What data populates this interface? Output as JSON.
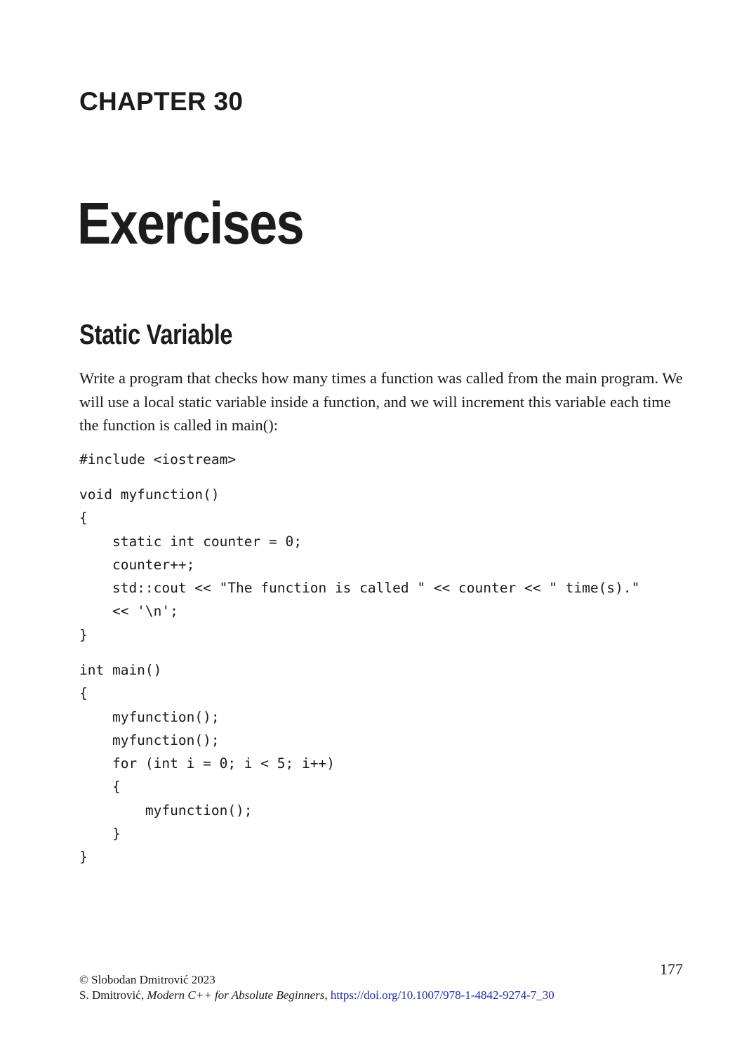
{
  "chapter": {
    "label": "CHAPTER 30",
    "title": "Exercises"
  },
  "section": {
    "title": "Static Variable",
    "paragraph": "Write a program that checks how many times a function was called from the main program. We will use a local static variable inside a function, and we will increment this variable each time the function is called in main():"
  },
  "code": {
    "include": [
      "#include <iostream>"
    ],
    "myfunction": [
      "void myfunction()",
      "{",
      "    static int counter = 0;",
      "    counter++;",
      "    std::cout << \"The function is called \" << counter << \" time(s).\"",
      "    << '\\n';",
      "}"
    ],
    "main": [
      "int main()",
      "{",
      "    myfunction();",
      "    myfunction();",
      "    for (int i = 0; i < 5; i++)",
      "    {",
      "        myfunction();",
      "    }",
      "}"
    ]
  },
  "footer": {
    "page_number": "177",
    "copyright": "© Slobodan Dmitrović 2023",
    "citation_author": "S. Dmitrović, ",
    "citation_book": "Modern C++ for Absolute Beginners",
    "citation_separator": ", ",
    "doi_link": "https://doi.org/10.1007/978-1-4842-9274-7_30",
    "link_color": "#1f2aa8"
  }
}
